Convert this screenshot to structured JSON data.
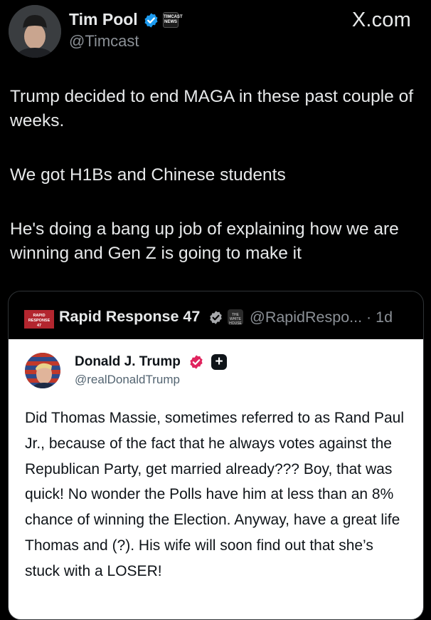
{
  "author": {
    "name": "Tim Pool",
    "handle": "@Timcast",
    "affiliate_badge": "TIMCAST NEWS"
  },
  "site_watermark": "X.com",
  "post": {
    "paragraphs": [
      "Trump decided to end MAGA in these past couple of weeks.",
      "We got H1Bs and Chinese students",
      "He's doing a bang up job of explaining how we are winning and Gen Z is going to make it"
    ]
  },
  "quote": {
    "author_name": "Rapid Response 47",
    "avatar_text": "RAPID RESPONSE 47",
    "affiliate_badge": "THE WHITE HOUSE",
    "handle_and_time": "@RapidRespo... · 1d",
    "embedded": {
      "author_name": "Donald J. Trump",
      "handle": "@realDonaldTrump",
      "body": "Did Thomas Massie, sometimes referred to as Rand Paul Jr., because of the fact that he always votes against the Republican Party, get married already??? Boy, that was quick! No wonder the Polls have him at less than an 8% chance of winning the Election. Anyway, have a great life Thomas and (?). His wife will soon find out that she’s stuck with a LOSER!"
    }
  },
  "colors": {
    "background": "#000000",
    "text": "#e7e9ea",
    "muted": "#8b9096",
    "verified_blue": "#1d9bf0",
    "verified_red": "#e0245e",
    "quote_avatar": "#b3262f"
  },
  "icons": [
    "verified-badge-icon",
    "affiliate-badge-icon",
    "plus-icon"
  ]
}
